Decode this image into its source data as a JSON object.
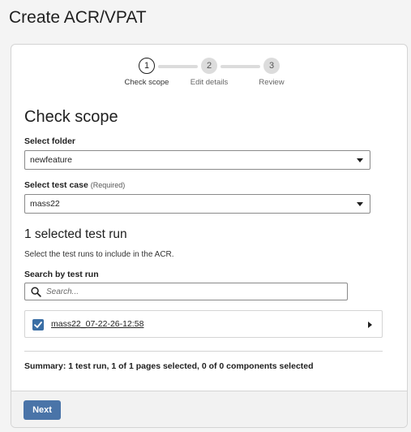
{
  "page": {
    "title": "Create ACR/VPAT"
  },
  "stepper": {
    "steps": [
      {
        "number": "1",
        "label": "Check scope"
      },
      {
        "number": "2",
        "label": "Edit details"
      },
      {
        "number": "3",
        "label": "Review"
      }
    ],
    "current_step": 1
  },
  "scope": {
    "title": "Check scope",
    "folder": {
      "label": "Select folder",
      "value": "newfeature"
    },
    "test_case": {
      "label": "Select test case",
      "required_note": "(Required)",
      "value": "mass22"
    }
  },
  "runs": {
    "title": "1 selected test run",
    "description": "Select the test runs to include in the ACR.",
    "search": {
      "label": "Search by test run",
      "placeholder": "Search..."
    },
    "items": [
      {
        "name": "mass22_07-22-26-12:58",
        "checked": true
      }
    ],
    "summary": "Summary: 1 test run, 1 of 1 pages selected, 0 of 0 components selected"
  },
  "footer": {
    "next_label": "Next"
  },
  "colors": {
    "accent": "#4a74a8",
    "checkbox": "#3a6ea5"
  },
  "icons": {
    "search": "search-icon",
    "check": "check-icon",
    "caret": "chevron-down-icon",
    "expand": "chevron-right-icon"
  }
}
